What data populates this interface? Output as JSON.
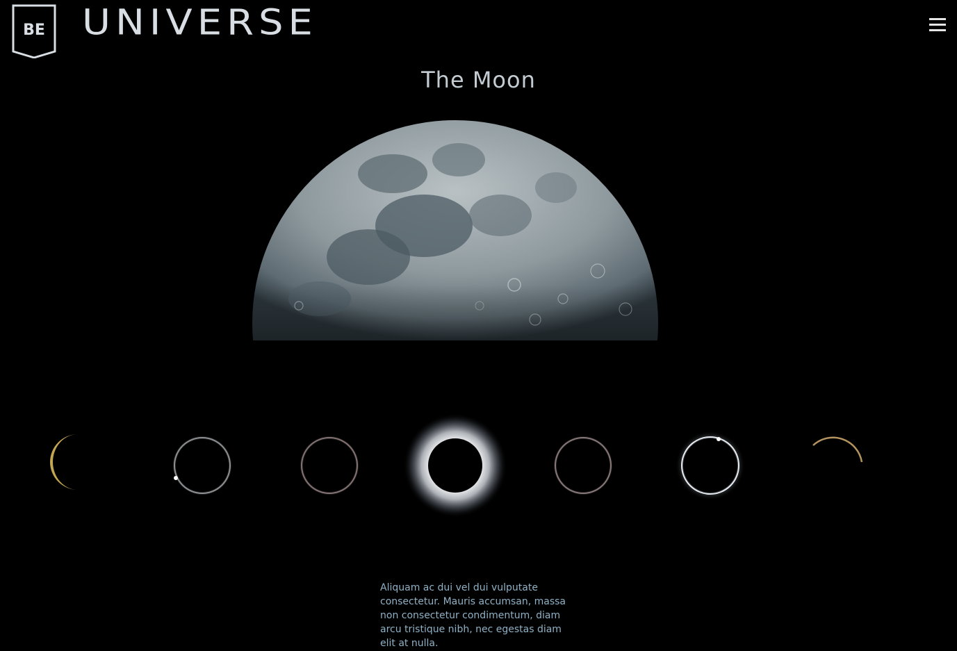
{
  "header": {
    "logo_text": "BE",
    "brand_name": "UNIVERSE",
    "menu_icon": "hamburger-menu-icon"
  },
  "main": {
    "title": "The Moon",
    "hero_image": "moon-half-image",
    "eclipse_phases": [
      {
        "name": "crescent-partial-eclipse-1"
      },
      {
        "name": "diamond-ring-phase-left"
      },
      {
        "name": "baily-beads-phase-left"
      },
      {
        "name": "total-eclipse-corona"
      },
      {
        "name": "baily-beads-phase-right"
      },
      {
        "name": "diamond-ring-phase-right"
      },
      {
        "name": "crescent-partial-eclipse-2"
      }
    ],
    "description": "Aliquam ac dui vel dui vulputate consectetur. Mauris accumsan, massa non consectetur condimentum, diam arcu tristique nibh, nec egestas diam elit at nulla."
  },
  "colors": {
    "background": "#000000",
    "brand_text": "#d8dee3",
    "title_text": "#c4ccd3",
    "description_text": "#8fb1c6",
    "crescent_gold": "#d8b85a"
  }
}
